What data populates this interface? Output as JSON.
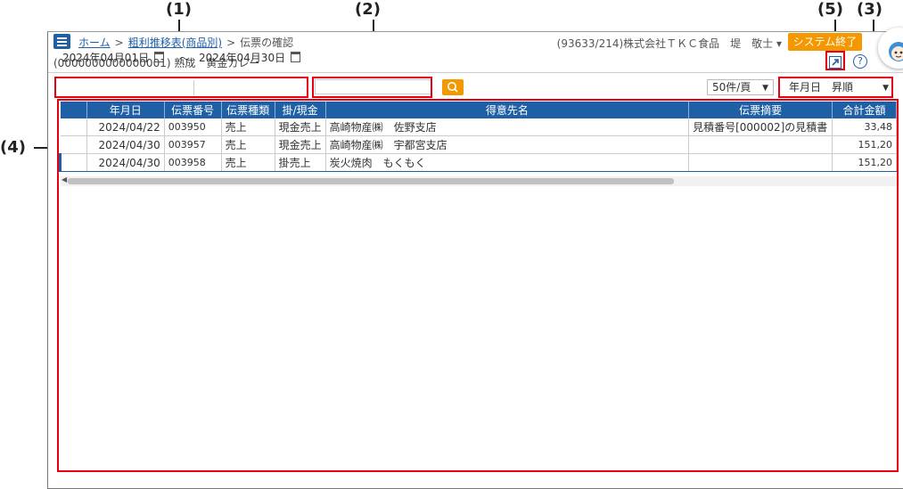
{
  "callouts": [
    "(1)",
    "(2)",
    "(3)",
    "(4)",
    "(5)"
  ],
  "header": {
    "breadcrumb": [
      "ホーム",
      "粗利推移表(商品別)",
      "伝票の確認"
    ],
    "breadcrumb_sep": ">",
    "company": "(93633/214)株式会社ＴＫＣ食品　堤　敬士 ▾",
    "system_exit": "システム終了"
  },
  "subheader": {
    "product": "(0000000000000001) 熟成　黄金カレー"
  },
  "filters": {
    "date_from": "2024年04月01日",
    "date_to": "2024年04月30日",
    "tilde": "～",
    "search_value": "",
    "per_page": "50件/頁",
    "sort": "年月日　昇順"
  },
  "table": {
    "columns": [
      "",
      "年月日",
      "伝票番号",
      "伝票種類",
      "掛/現金",
      "得意先名",
      "伝票摘要",
      "合計金額"
    ],
    "rows": [
      [
        "",
        "2024/04/22",
        "003950",
        "売上",
        "現金売上",
        "高崎物産㈱　佐野支店",
        "見積番号[000002]の見積書",
        "33,48"
      ],
      [
        "",
        "2024/04/30",
        "003957",
        "売上",
        "現金売上",
        "高崎物産㈱　宇都宮支店",
        "",
        "151,20"
      ],
      [
        "",
        "2024/04/30",
        "003958",
        "売上",
        "掛売上",
        "炭火焼肉　もくもく",
        "",
        "151,20"
      ]
    ]
  },
  "colors": {
    "accent": "#1f5fa6",
    "orange": "#f39800",
    "callout_red": "#e60012"
  },
  "icons": [
    "menu-icon",
    "calendar-icon",
    "search-icon",
    "external-link-icon",
    "help-icon",
    "avatar-icon"
  ]
}
